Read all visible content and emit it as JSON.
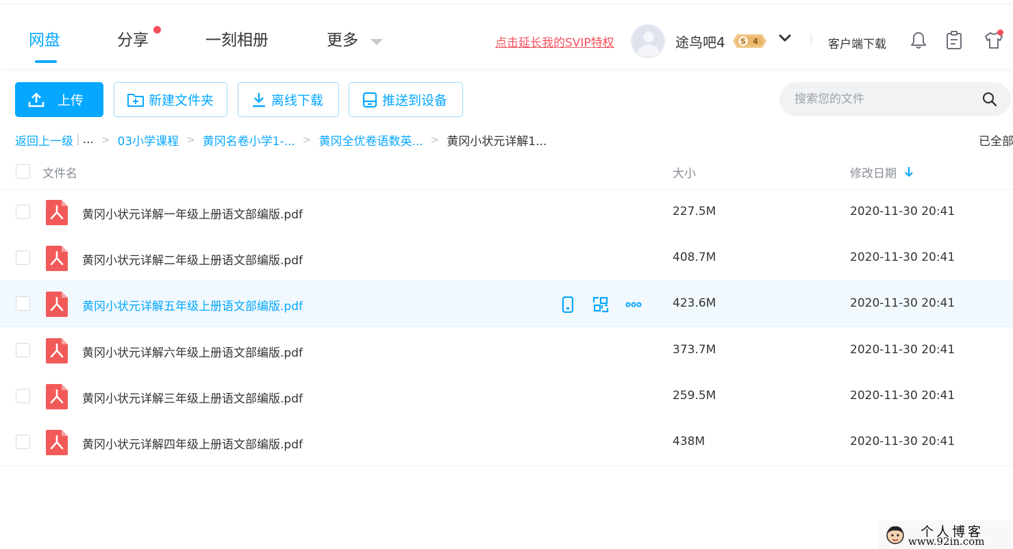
{
  "nav": {
    "tabs": [
      {
        "label": "网盘",
        "active": true
      },
      {
        "label": "分享",
        "has_dot": true
      },
      {
        "label": "一刻相册"
      },
      {
        "label": "更多"
      }
    ],
    "svip_link": "点击延长我的SVIP特权",
    "username": "途鸟吧4",
    "vip_badge": {
      "letter": "S",
      "level": "4"
    },
    "client_download": "客户端下载",
    "icons": [
      "bell-icon",
      "clipboard-icon",
      "tshirt-icon"
    ]
  },
  "toolbar": {
    "upload": "上传",
    "new_folder": "新建文件夹",
    "offline_download": "离线下载",
    "push_device": "推送到设备",
    "search_placeholder": "搜索您的文件"
  },
  "breadcrumb": {
    "back": "返回上一级",
    "ellipsis": "...",
    "items": [
      "03小学课程",
      "黄冈名卷小学1-...",
      "黄冈全优卷语数英...",
      "黄冈小状元详解1..."
    ],
    "loaded_all": "已全部"
  },
  "table": {
    "headers": {
      "name": "文件名",
      "size": "大小",
      "date": "修改日期"
    },
    "sort": "date-desc",
    "rows": [
      {
        "name": "黄冈小状元详解一年级上册语文部编版.pdf",
        "size": "227.5M",
        "date": "2020-11-30 20:41"
      },
      {
        "name": "黄冈小状元详解二年级上册语文部编版.pdf",
        "size": "408.7M",
        "date": "2020-11-30 20:41"
      },
      {
        "name": "黄冈小状元详解五年级上册语文部编版.pdf",
        "size": "423.6M",
        "date": "2020-11-30 20:41",
        "hovered": true
      },
      {
        "name": "黄冈小状元详解六年级上册语文部编版.pdf",
        "size": "373.7M",
        "date": "2020-11-30 20:41"
      },
      {
        "name": "黄冈小状元详解三年级上册语文部编版.pdf",
        "size": "259.5M",
        "date": "2020-11-30 20:41"
      },
      {
        "name": "黄冈小状元详解四年级上册语文部编版.pdf",
        "size": "438M",
        "date": "2020-11-30 20:41"
      }
    ],
    "row_actions": [
      "push-to-phone-icon",
      "share-qr-icon",
      "more-options-icon"
    ]
  },
  "watermark": {
    "title": "个人博客",
    "url": "www.92in.com"
  },
  "colors": {
    "accent": "#06a7ff",
    "alert": "#f4505d",
    "pdf": "#f25a5a",
    "hover_row": "#f1f9fe"
  }
}
